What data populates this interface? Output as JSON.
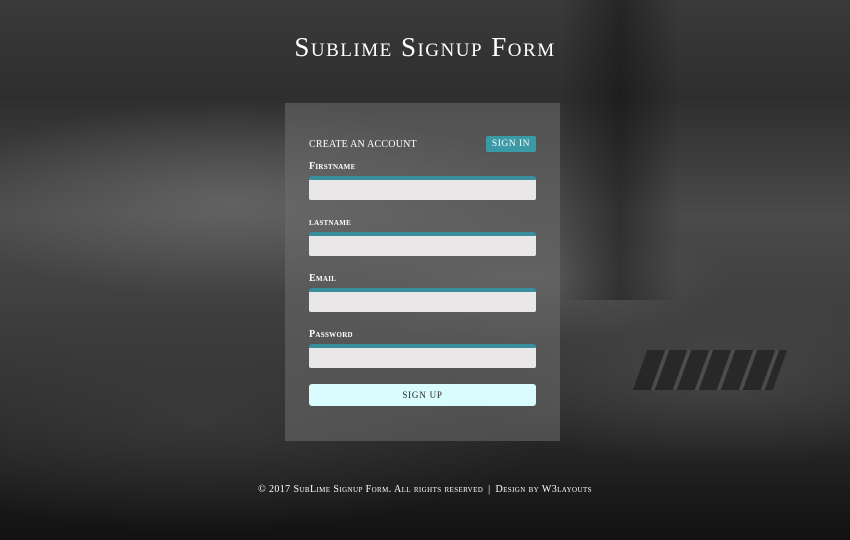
{
  "page": {
    "title": "Sublime Signup Form"
  },
  "form": {
    "heading": "Create an account",
    "signin_label": "Sign In",
    "fields": [
      {
        "label": "Firstname",
        "value": ""
      },
      {
        "label": "lastname",
        "value": ""
      },
      {
        "label": "Email",
        "value": ""
      },
      {
        "label": "Password",
        "value": ""
      }
    ],
    "signup_label": "Sign Up"
  },
  "footer": {
    "copyright": "© 2017  SubLime Signup Form. All rights reserved",
    "separator": "|",
    "credit": "Design by W3layouts"
  },
  "colors": {
    "accent": "#3a9aa6",
    "input_border": "#3a8f9e",
    "signup_button": "#d9fcff"
  }
}
